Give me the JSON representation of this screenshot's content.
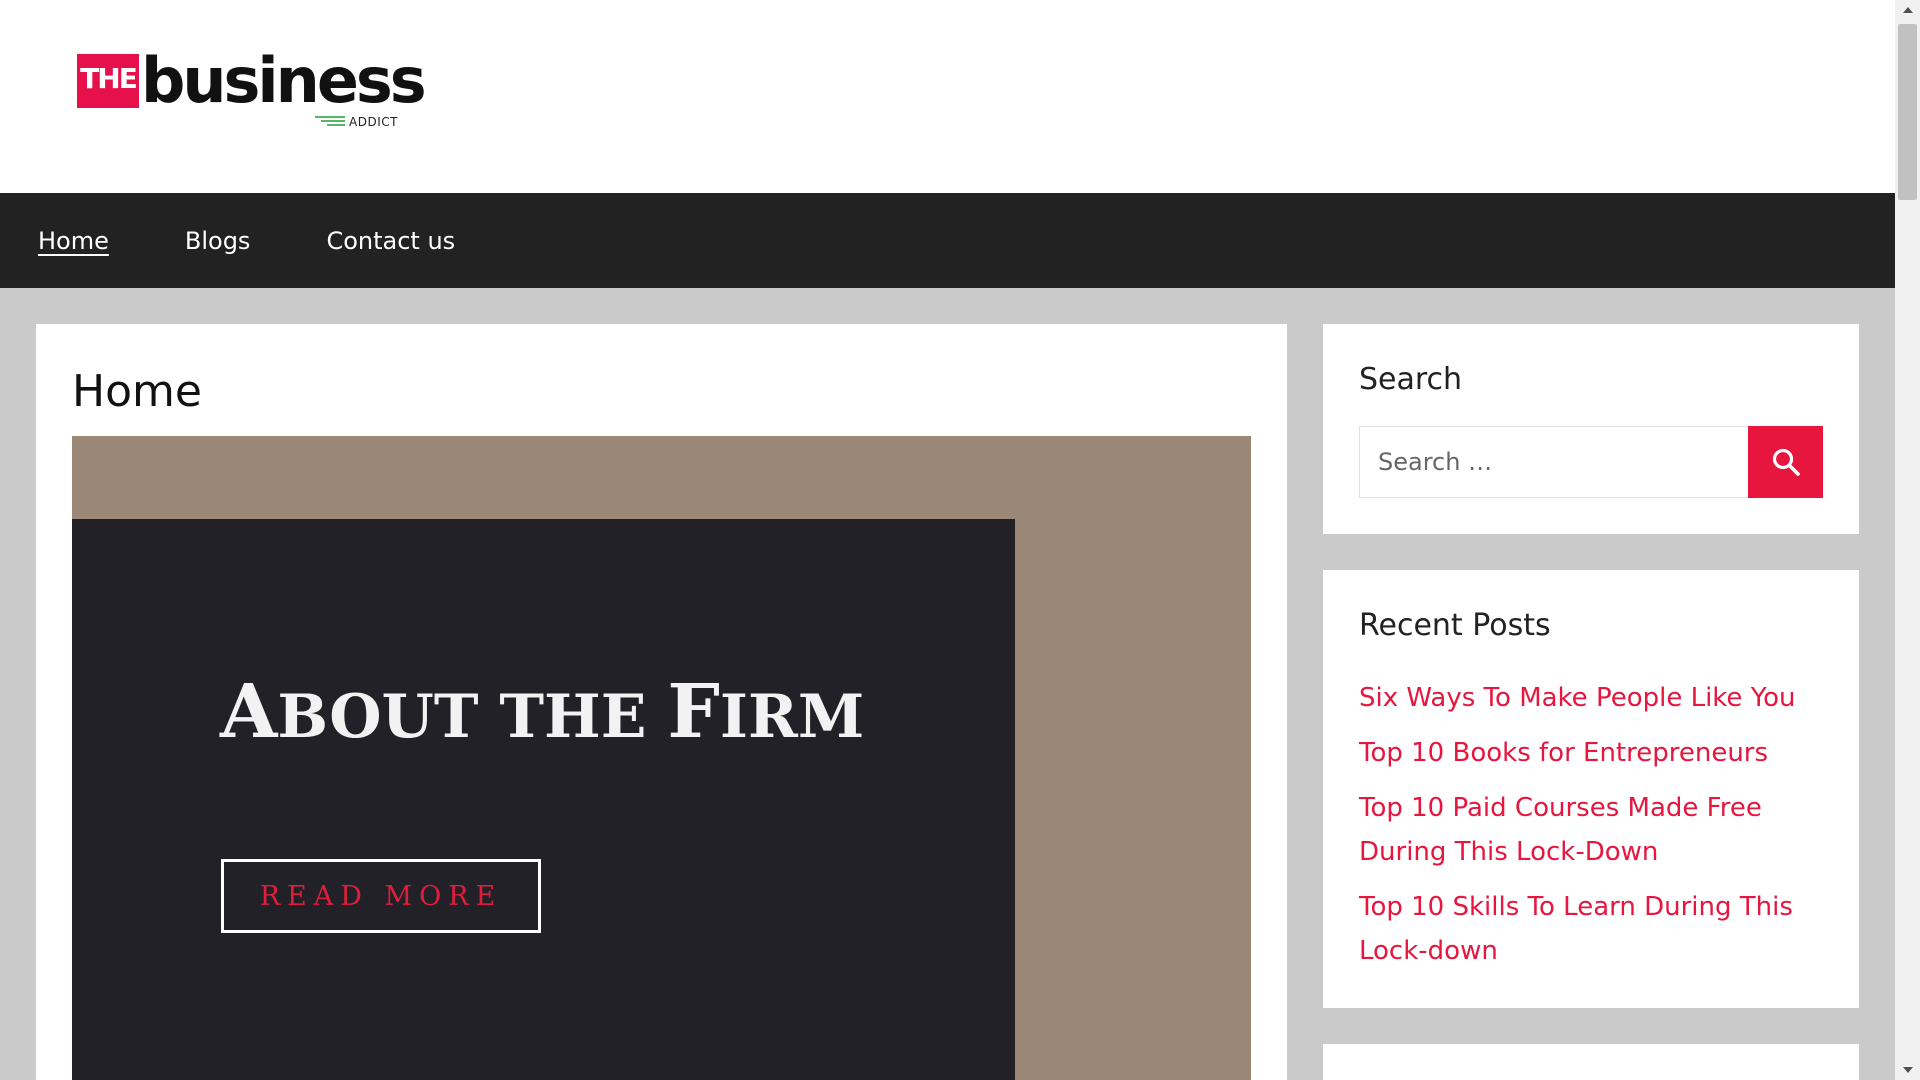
{
  "logo": {
    "the": "THE",
    "business": "business",
    "addict": "ADDICT"
  },
  "nav": {
    "items": [
      {
        "label": "Home",
        "active": true
      },
      {
        "label": "Blogs",
        "active": false
      },
      {
        "label": "Contact us",
        "active": false
      }
    ]
  },
  "main": {
    "title": "Home",
    "hero": {
      "heading_cap1": "A",
      "heading_rest1": "BOUT THE ",
      "heading_cap2": "F",
      "heading_rest2": "IRM",
      "button_label": "READ MORE"
    }
  },
  "sidebar": {
    "search": {
      "title": "Search",
      "placeholder": "Search …"
    },
    "recent_posts": {
      "title": "Recent Posts",
      "items": [
        "Six Ways To Make People Like You",
        "Top 10 Books for Entrepreneurs",
        "Top 10 Paid Courses Made Free During This Lock-Down",
        "Top 10 Skills To Learn During This Lock-down"
      ]
    }
  },
  "colors": {
    "accent": "#e6163f",
    "nav_bg": "#222222",
    "hero_bg": "#9a8775",
    "hero_card": "#222127",
    "page_bg": "#cacaca"
  }
}
